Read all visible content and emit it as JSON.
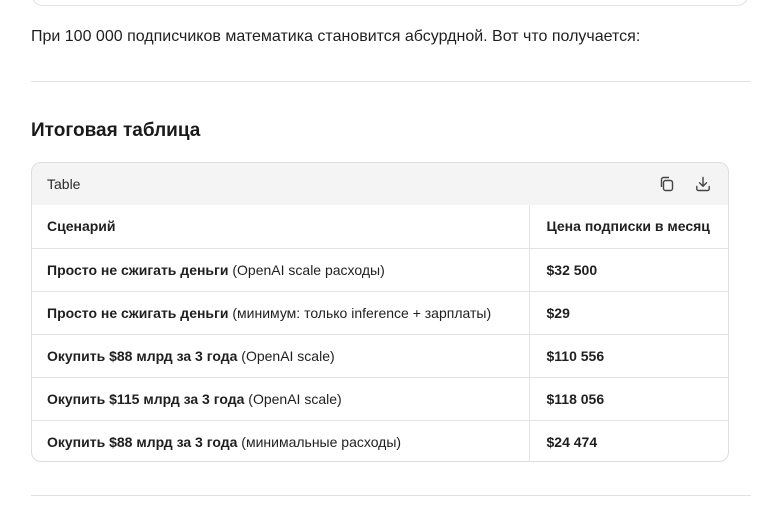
{
  "intro_text": "При 100 000 подписчиков математика становится абсурдной. Вот что получается:",
  "section_title": "Итоговая таблица",
  "table": {
    "label": "Table",
    "copy_icon": "copy-icon",
    "download_icon": "download-icon",
    "columns": [
      "Сценарий",
      "Цена подписки в месяц"
    ],
    "rows": [
      {
        "scenario_bold": "Просто не сжигать деньги",
        "scenario_note": " (OpenAI scale расходы)",
        "price": "$32 500"
      },
      {
        "scenario_bold": "Просто не сжигать деньги",
        "scenario_note": " (минимум: только inference + зарплаты)",
        "price": "$29"
      },
      {
        "scenario_bold": "Окупить $88 млрд за 3 года",
        "scenario_note": " (OpenAI scale)",
        "price": "$110 556"
      },
      {
        "scenario_bold": "Окупить $115 млрд за 3 года",
        "scenario_note": " (OpenAI scale)",
        "price": "$118 056"
      },
      {
        "scenario_bold": "Окупить $88 млрд за 3 года",
        "scenario_note": " (минимальные расходы)",
        "price": "$24 474"
      }
    ]
  },
  "colors": {
    "text": "#1f1f1f",
    "header_bar": "#f4f4f4",
    "border": "#e3e3e3"
  }
}
